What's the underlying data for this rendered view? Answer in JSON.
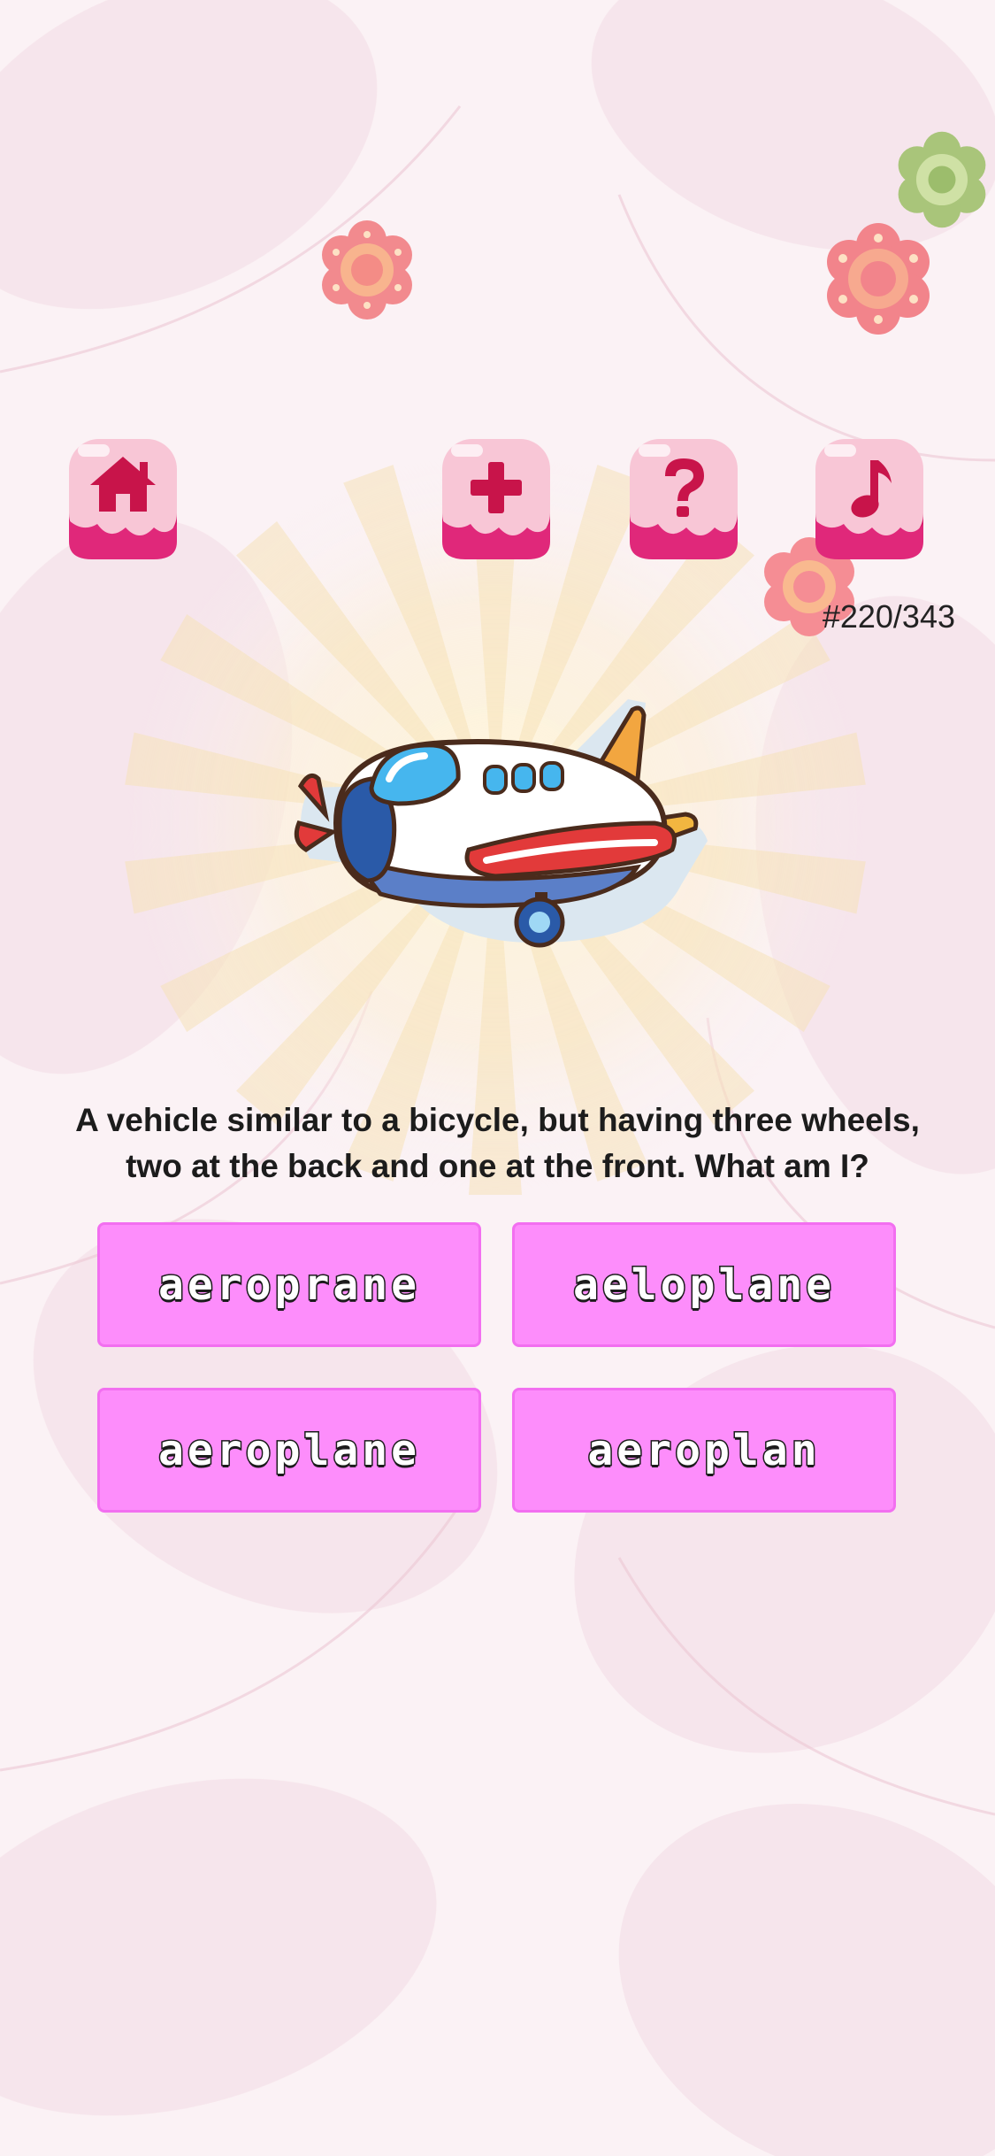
{
  "toolbar": {
    "home_icon": "home-icon",
    "add_icon": "plus-icon",
    "help_icon": "question-icon",
    "music_icon": "music-note-icon"
  },
  "progress": {
    "label": "#220/343",
    "current": 220,
    "total": 343
  },
  "question": {
    "line1": "A vehicle similar to a bicycle, but having three wheels,",
    "line2": "two at the back and one at the front. What am I?",
    "image": "aeroplane-illustration"
  },
  "answers": [
    {
      "label": "aeroprane"
    },
    {
      "label": "aeloplane"
    },
    {
      "label": "aeroplane"
    },
    {
      "label": "aeroplan"
    }
  ],
  "colors": {
    "button_pink": "#fd8dfb",
    "toolbar_icon": "#c8144a",
    "background": "#fbf3f6"
  }
}
